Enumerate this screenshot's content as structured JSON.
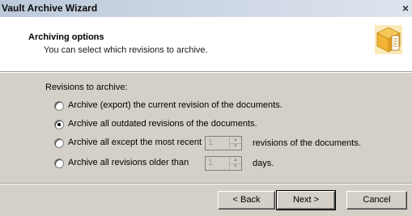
{
  "window": {
    "title": "Vault Archive Wizard",
    "close_glyph": "×"
  },
  "header": {
    "title": "Archiving options",
    "subtitle": "You can select which revisions to archive.",
    "icon": "archive-box-icon"
  },
  "options": {
    "group_label": "Revisions to archive:",
    "items": [
      {
        "label": "Archive (export) the current revision of the documents.",
        "selected": false
      },
      {
        "label": "Archive all outdated revisions of the documents.",
        "selected": true
      },
      {
        "label": "Archive all except the most recent",
        "selected": false,
        "spin_value": "1",
        "suffix": "revisions of the documents."
      },
      {
        "label": "Archive all revisions older than",
        "selected": false,
        "spin_value": "1",
        "suffix": "days."
      }
    ]
  },
  "footer": {
    "back_label": "< Back",
    "next_label": "Next >",
    "cancel_label": "Cancel"
  }
}
